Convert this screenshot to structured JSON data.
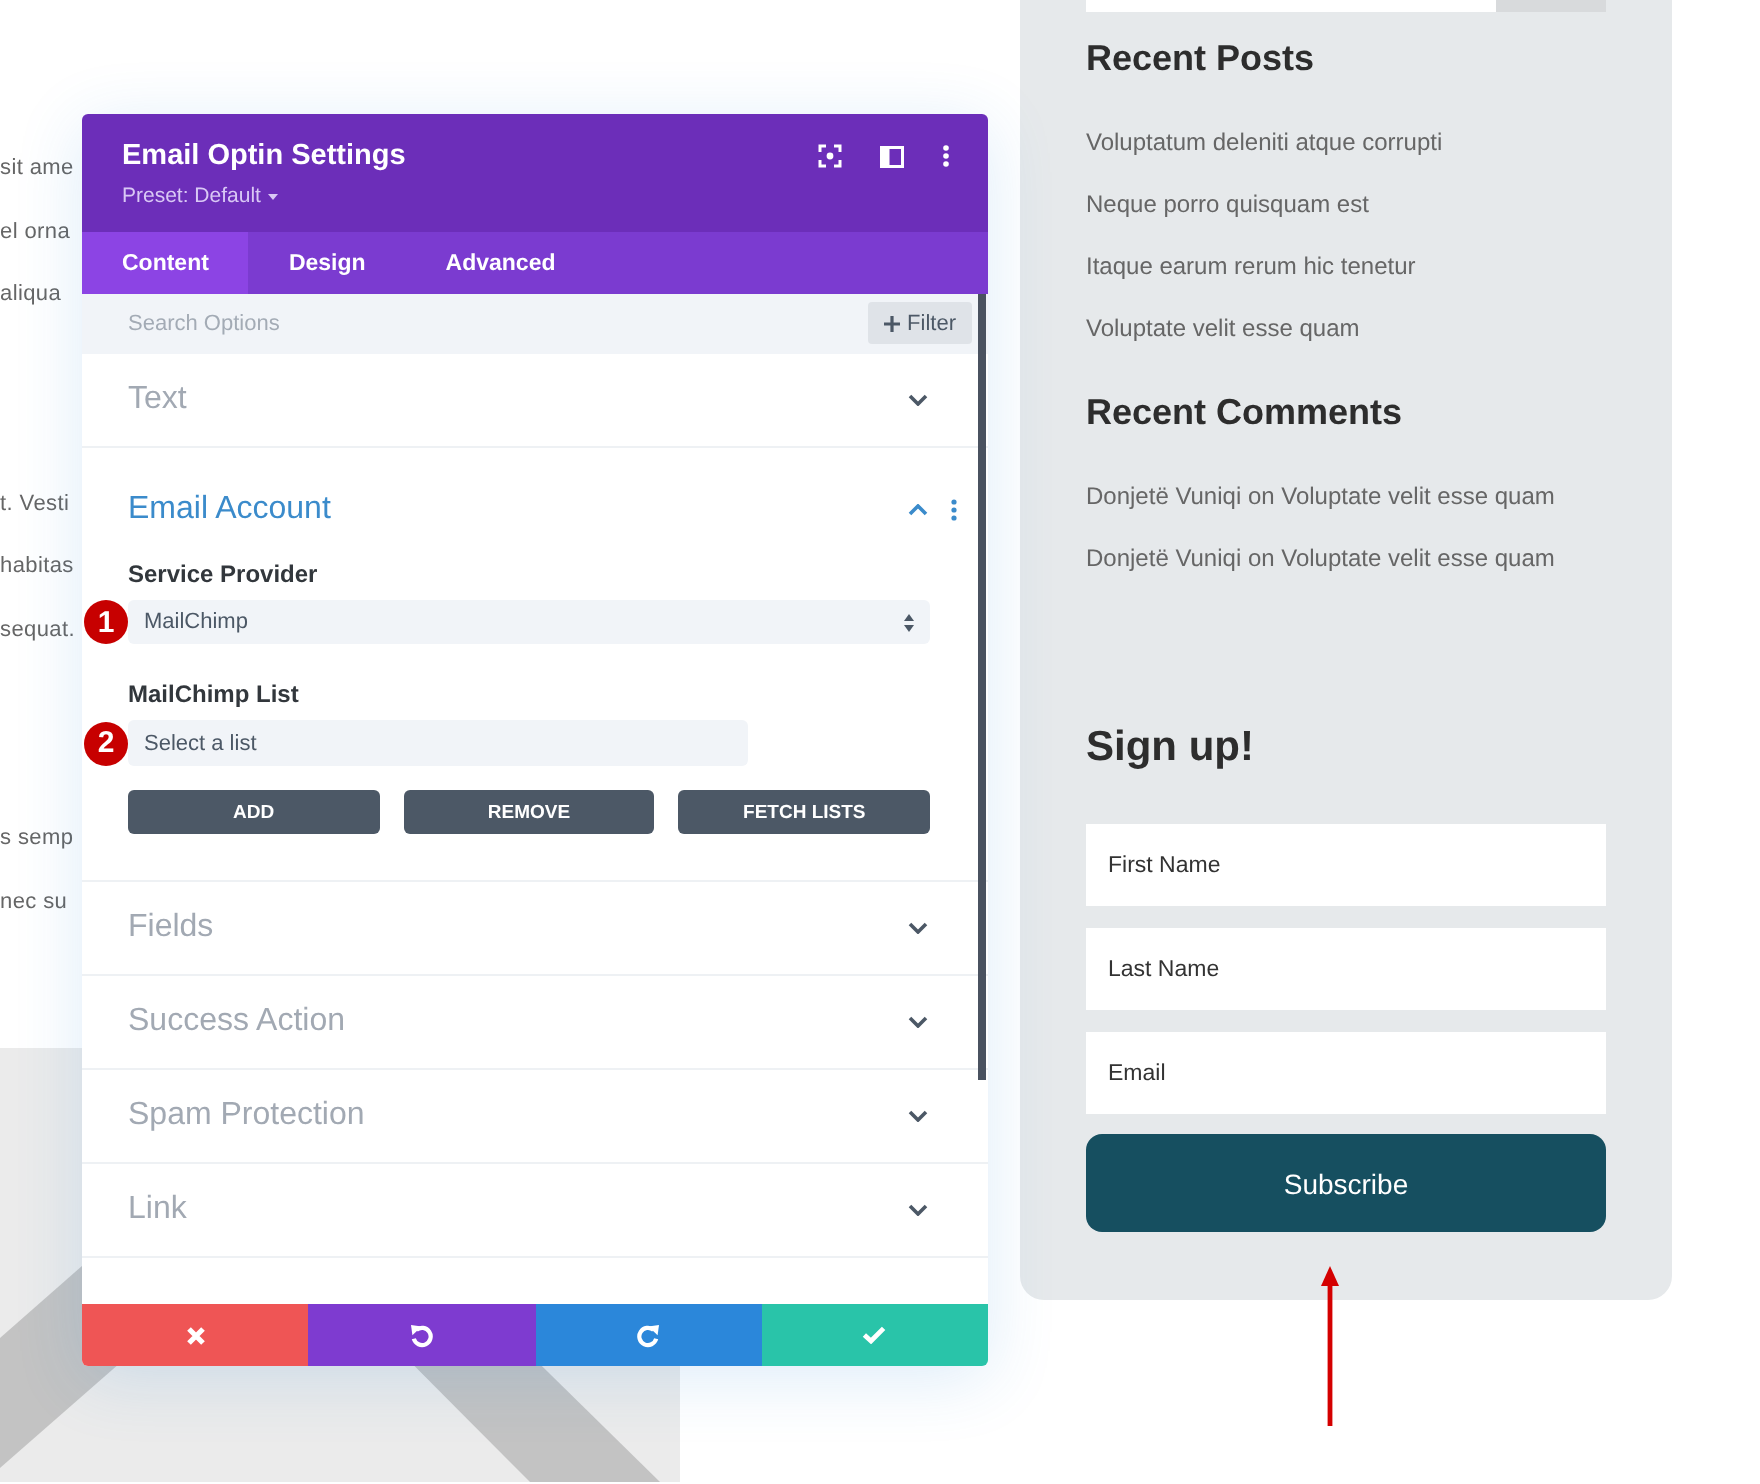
{
  "page_text": [
    [
      "sit ame",
      "el orna",
      "aliqua"
    ],
    [
      "t. Vesti",
      "habitas",
      "sequat."
    ],
    [
      "s semp",
      "nec su"
    ]
  ],
  "settings_modal": {
    "title": "Email Optin Settings",
    "preset": "Preset: Default",
    "tabs": [
      {
        "label": "Content",
        "selected": true
      },
      {
        "label": "Design",
        "selected": false
      },
      {
        "label": "Advanced",
        "selected": false
      }
    ],
    "search": {
      "placeholder": "Search Options"
    },
    "filter_button": "Filter",
    "sections": [
      {
        "title": "Text",
        "expanded": false
      },
      {
        "title": "Email Account",
        "expanded": true,
        "controls": [
          {
            "kind": "select",
            "label": "Service Provider",
            "value": "MailChimp",
            "badge": "1"
          },
          {
            "kind": "field",
            "label": "MailChimp List",
            "value": "Select a list",
            "badge": "2"
          },
          {
            "kind": "buttons",
            "buttons": [
              "ADD",
              "REMOVE",
              "FETCH LISTS"
            ]
          }
        ]
      },
      {
        "title": "Fields",
        "expanded": false
      },
      {
        "title": "Success Action",
        "expanded": false
      },
      {
        "title": "Spam Protection",
        "expanded": false
      },
      {
        "title": "Link",
        "expanded": false
      }
    ],
    "footer_buttons": [
      {
        "kind": "cancel"
      },
      {
        "kind": "undo"
      },
      {
        "kind": "redo"
      },
      {
        "kind": "save"
      }
    ]
  },
  "sidebar": {
    "recent_posts": {
      "title": "Recent Posts",
      "items": [
        "Voluptatum deleniti atque corrupti",
        "Neque porro quisquam est",
        "Itaque earum rerum hic tenetur",
        "Voluptate velit esse quam"
      ]
    },
    "recent_comments": {
      "title": "Recent Comments",
      "items": [
        "Donjetë Vuniqi on Voluptate velit esse quam",
        "Donjetë Vuniqi on Voluptate velit esse quam"
      ]
    },
    "signup": {
      "title": "Sign up!",
      "fields": [
        {
          "placeholder": "First Name"
        },
        {
          "placeholder": "Last Name"
        },
        {
          "placeholder": "Email"
        }
      ],
      "button": "Subscribe"
    }
  }
}
